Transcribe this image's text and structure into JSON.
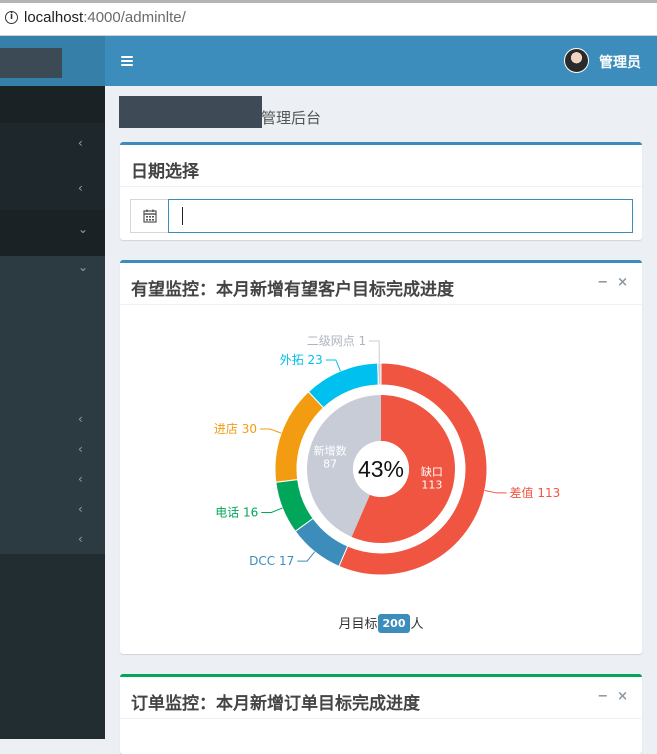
{
  "browser": {
    "url_host": "localhost",
    "url_rest": ":4000/adminlte/"
  },
  "header": {
    "admin_name": "管理员"
  },
  "page": {
    "title_suffix": "管理后台"
  },
  "date_box": {
    "title": "日期选择",
    "input_value": ""
  },
  "prospect_box": {
    "title": "有望监控：本月新增有望客户目标完成进度",
    "minimize_label": "−",
    "close_label": "×",
    "center_label": "43%",
    "goal_prefix": "月目标",
    "goal_value": "200",
    "goal_suffix": "人"
  },
  "order_box": {
    "title": "订单监控：本月新增订单目标完成进度",
    "minimize_label": "−",
    "close_label": "×"
  },
  "sidebar": {
    "chevrons": [
      "<",
      "<",
      "v",
      "v",
      "<",
      "<",
      "<",
      "<",
      "<"
    ]
  },
  "colors": {
    "topbar": "#3c8dbc",
    "sidebar": "#222d32",
    "red": "#f05542",
    "orange": "#f39c12",
    "green": "#00a65a",
    "blue": "#3c8dbc",
    "sky": "#00c0ef",
    "gray": "#d2d6de",
    "inner_gray": "#c8ccd7"
  },
  "chart_data": {
    "type": "pie",
    "center_label": "43%",
    "inner": [
      {
        "name": "新增数",
        "value": 87,
        "color": "#c8ccd7"
      },
      {
        "name": "缺口",
        "value": 113,
        "color": "#f05542"
      }
    ],
    "outer": [
      {
        "name": "差值",
        "value": 113,
        "color": "#f05542"
      },
      {
        "name": "DCC",
        "value": 17,
        "color": "#3c8dbc"
      },
      {
        "name": "电话",
        "value": 16,
        "color": "#00a65a"
      },
      {
        "name": "进店",
        "value": 30,
        "color": "#f39c12"
      },
      {
        "name": "外拓",
        "value": 23,
        "color": "#00c0ef"
      },
      {
        "name": "二级网点",
        "value": 1,
        "color": "#c8ccd7"
      }
    ]
  }
}
